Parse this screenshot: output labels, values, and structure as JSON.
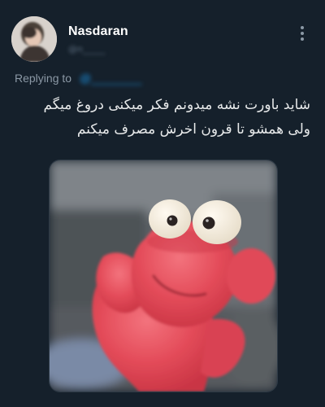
{
  "tweet": {
    "display_name": "Nasdaran",
    "handle": "@n_____",
    "reply_label": "Replying to",
    "reply_handle": "@________",
    "text_lines": [
      "شاید باورت نشه میدونم فکر میکنی دروغ میگم",
      "ولی همشو تا قرون اخرش مصرف میکنم"
    ]
  },
  "icons": {
    "more": "more-vertical-icon"
  },
  "colors": {
    "background": "#15202b",
    "name": "#ffffff",
    "secondary": "#8b98a5",
    "link": "#1d9bf0",
    "text": "#e7e9ea",
    "character_red": "#e9515e"
  }
}
